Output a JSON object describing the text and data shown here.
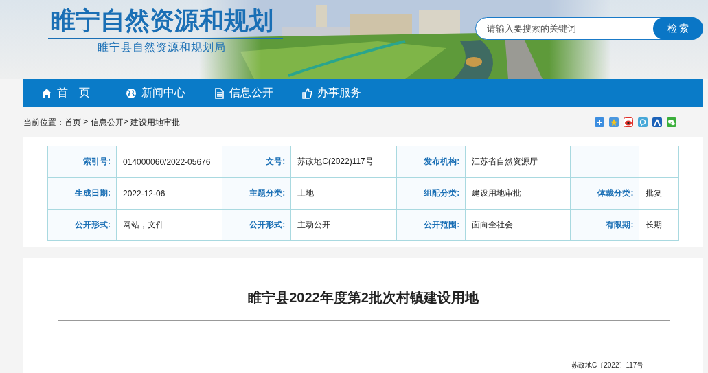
{
  "header": {
    "title": "睢宁自然资源和规划",
    "subtitle": "睢宁县自然资源和规划局",
    "search": {
      "placeholder": "请输入要搜索的关键词",
      "button": "检 索"
    }
  },
  "nav": [
    {
      "label": "首　页"
    },
    {
      "label": "新闻中心"
    },
    {
      "label": "信息公开"
    },
    {
      "label": "办事服务"
    }
  ],
  "breadcrumb": {
    "prefix": "当前位置：",
    "items": [
      {
        "label": "首页",
        "sep": " > "
      },
      {
        "label": "信息公开",
        "sep": "> "
      },
      {
        "label": "建设用地审批"
      }
    ]
  },
  "meta": {
    "rows": [
      [
        {
          "label": "索引号:",
          "value": "014000060/2022-05676"
        },
        {
          "label": "文号:",
          "value": "苏政地C(2022)117号"
        },
        {
          "label": "发布机构:",
          "value": "江苏省自然资源厅"
        },
        {}
      ],
      [
        {
          "label": "生成日期:",
          "value": "2022-12-06"
        },
        {
          "label": "主题分类:",
          "value": "土地"
        },
        {
          "label": "组配分类:",
          "value": "建设用地审批"
        },
        {
          "label": "体裁分类:",
          "value": "批复"
        }
      ],
      [
        {
          "label": "公开形式:",
          "value": "网站，文件"
        },
        {
          "label": "公开形式:",
          "value": "主动公开"
        },
        {
          "label": "公开范围:",
          "value": "面向全社会"
        },
        {
          "label": "有限期:",
          "value": "长期"
        }
      ]
    ]
  },
  "article": {
    "title": "睢宁县2022年度第2批次村镇建设用地",
    "doc_number": "苏政地C〔2022〕117号"
  }
}
